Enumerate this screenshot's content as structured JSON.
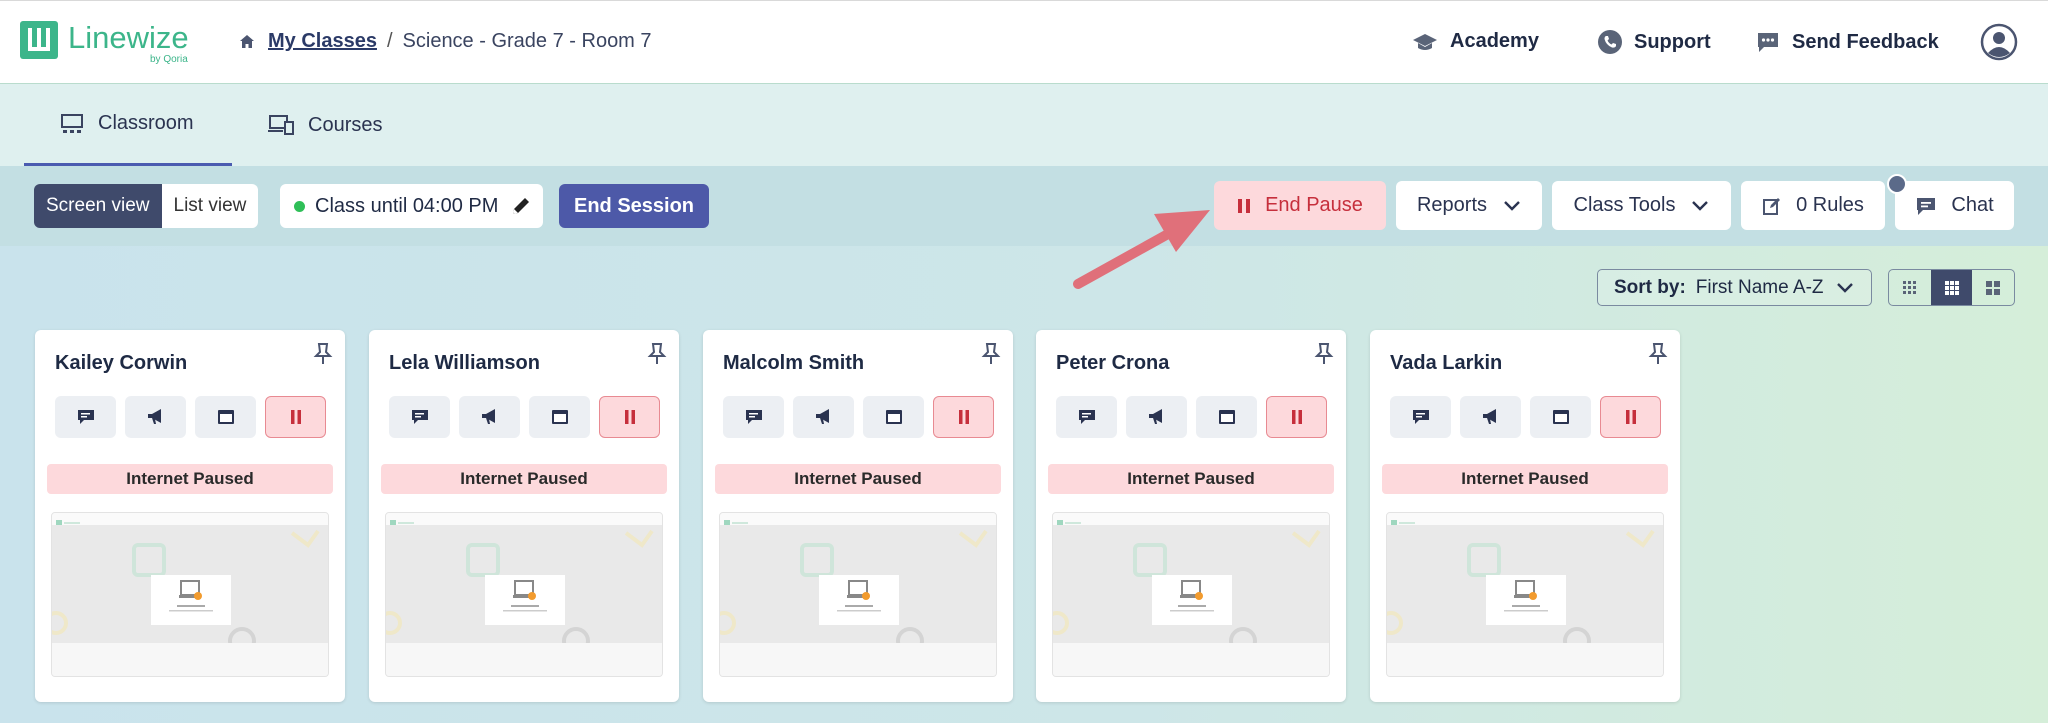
{
  "brand": {
    "name": "Linewize",
    "sub": "by Qoria",
    "color": "#3cb58a"
  },
  "breadcrumb": {
    "root": "My Classes",
    "sep": "/",
    "current": "Science - Grade 7 - Room 7"
  },
  "toplinks": {
    "academy": "Academy",
    "support": "Support",
    "feedback": "Send Feedback"
  },
  "tabs": [
    {
      "label": "Classroom",
      "active": true
    },
    {
      "label": "Courses",
      "active": false
    }
  ],
  "toolbar": {
    "screen_view": "Screen view",
    "list_view": "List view",
    "class_until": "Class until 04:00 PM",
    "end_session": "End Session",
    "end_pause": "End Pause",
    "reports": "Reports",
    "class_tools": "Class Tools",
    "rules": "0 Rules",
    "chat": "Chat"
  },
  "sort": {
    "label": "Sort by:",
    "value": "First Name A-Z"
  },
  "students": [
    {
      "name": "Kailey Corwin",
      "status": "Internet Paused"
    },
    {
      "name": "Lela Williamson",
      "status": "Internet Paused"
    },
    {
      "name": "Malcolm Smith",
      "status": "Internet Paused"
    },
    {
      "name": "Peter Crona",
      "status": "Internet Paused"
    },
    {
      "name": "Vada Larkin",
      "status": "Internet Paused"
    }
  ],
  "colors": {
    "primary": "#4d59a8",
    "pause_bg": "#fdd9dc",
    "pause_fg": "#c62f3c",
    "active_dot": "#2fbf58",
    "arrow": "#e0707a"
  }
}
